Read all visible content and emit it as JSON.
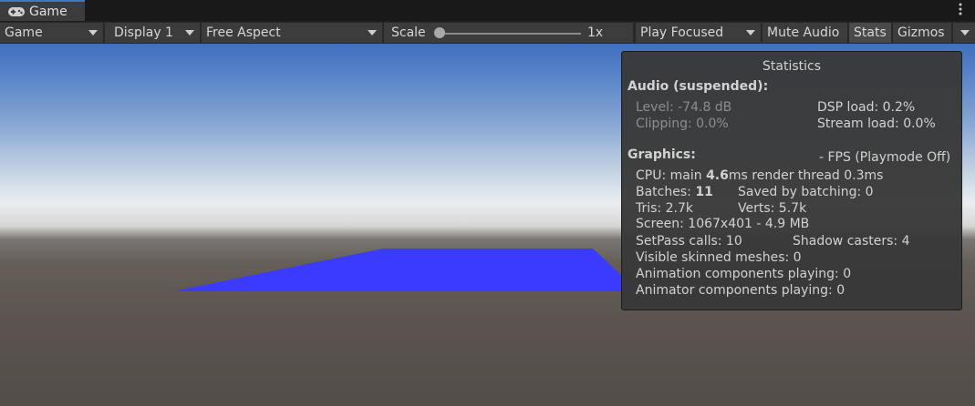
{
  "tab": {
    "icon": "gamepad-icon",
    "label": "Game"
  },
  "tab_menu_icon": "kebab-menu-icon",
  "toolbar": {
    "mode": "Game",
    "display": "Display 1",
    "aspect": "Free Aspect",
    "scale_label": "Scale",
    "scale_value": "1x",
    "scale_fraction": 0.0,
    "play_mode": "Play Focused",
    "mute_audio": "Mute Audio",
    "stats": "Stats",
    "gizmos": "Gizmos"
  },
  "stats_panel": {
    "title": "Statistics",
    "audio_header": "Audio (suspended):",
    "level": "Level: -74.8 dB",
    "clipping": "Clipping: 0.0%",
    "dsp_load": "DSP load: 0.2%",
    "stream_load": "Stream load: 0.0%",
    "graphics_header": "Graphics:",
    "fps": "- FPS (Playmode Off)",
    "cpu_prefix": "CPU: main ",
    "cpu_main": "4.6",
    "cpu_suffix": "ms  render thread 0.3ms",
    "batches_prefix": "Batches: ",
    "batches_value": "11",
    "saved_by_batching": "Saved by batching: 0",
    "tris": "Tris: 2.7k",
    "verts": "Verts: 5.7k",
    "screen": "Screen: 1067x401 - 4.9 MB",
    "setpass": "SetPass calls: 10",
    "shadow_casters": "Shadow casters: 4",
    "skinned": "Visible skinned meshes: 0",
    "animation": "Animation components playing: 0",
    "animator": "Animator components playing: 0"
  },
  "colors": {
    "plane": "#3b3bff",
    "tab_accent": "#3a79bb",
    "panel_bg": "#383838"
  }
}
